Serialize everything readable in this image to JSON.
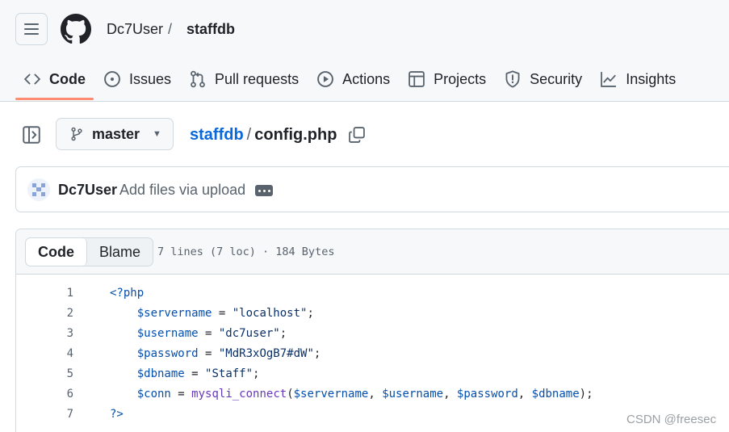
{
  "header": {
    "owner": "Dc7User",
    "separator": "/",
    "repo": "staffdb"
  },
  "nav": {
    "items": [
      {
        "label": "Code",
        "icon": "code-icon",
        "active": true
      },
      {
        "label": "Issues",
        "icon": "issue-opened-icon"
      },
      {
        "label": "Pull requests",
        "icon": "git-pull-request-icon"
      },
      {
        "label": "Actions",
        "icon": "play-icon"
      },
      {
        "label": "Projects",
        "icon": "table-icon"
      },
      {
        "label": "Security",
        "icon": "shield-icon"
      },
      {
        "label": "Insights",
        "icon": "graph-icon"
      }
    ]
  },
  "filebar": {
    "branch": "master",
    "path_repo": "staffdb",
    "path_sep": "/",
    "path_file": "config.php"
  },
  "commit": {
    "author": "Dc7User",
    "message": "Add files via upload"
  },
  "viewer": {
    "tab_code": "Code",
    "tab_blame": "Blame",
    "file_info": "7 lines (7 loc) · 184 Bytes",
    "lines": [
      {
        "num": "1",
        "text": "<?php"
      },
      {
        "num": "2",
        "text": "    $servername = \"localhost\";"
      },
      {
        "num": "3",
        "text": "    $username = \"dc7user\";"
      },
      {
        "num": "4",
        "text": "    $password = \"MdR3xOgB7#dW\";"
      },
      {
        "num": "5",
        "text": "    $dbname = \"Staff\";"
      },
      {
        "num": "6",
        "text": "    $conn = mysqli_connect($servername, $username, $password, $dbname);"
      },
      {
        "num": "7",
        "text": "?>"
      }
    ]
  },
  "watermark": "CSDN @freesec",
  "colors": {
    "accent_underline": "#fd8c73",
    "link": "#0969da"
  }
}
